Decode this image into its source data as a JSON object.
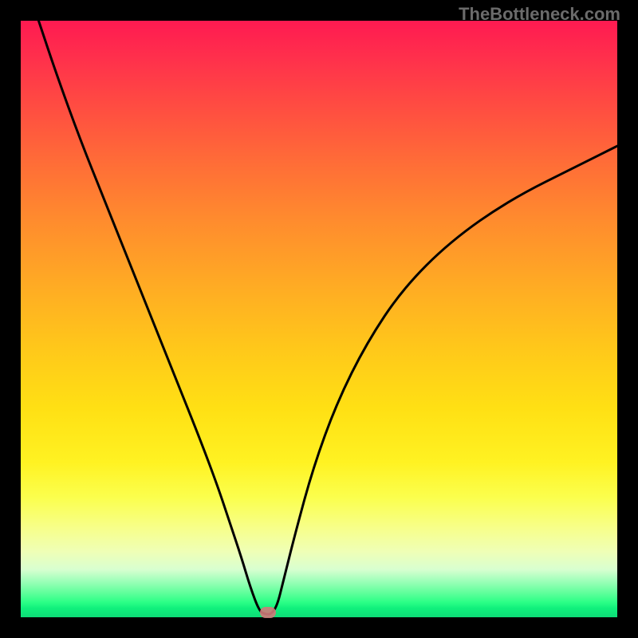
{
  "watermark": "TheBottleneck.com",
  "chart_data": {
    "type": "line",
    "title": "",
    "xlabel": "",
    "ylabel": "",
    "xlim": [
      0,
      100
    ],
    "ylim": [
      0,
      100
    ],
    "background_gradient": {
      "top": "#ff1a51",
      "mid_orange": "#ff8a2e",
      "mid_yellow": "#ffe014",
      "bottom": "#0ddc77"
    },
    "series": [
      {
        "name": "bottleneck-curve",
        "color": "#000000",
        "x": [
          3,
          6,
          10,
          14,
          18,
          22,
          26,
          30,
          33,
          35,
          37,
          38.5,
          40,
          41,
          42,
          43,
          44,
          46,
          49,
          53,
          58,
          64,
          72,
          82,
          94,
          100
        ],
        "y": [
          100,
          91,
          80,
          70,
          60,
          50,
          40,
          30,
          22,
          16,
          10,
          5,
          1,
          0.5,
          0.5,
          2,
          6,
          14,
          25,
          36,
          46,
          55,
          63,
          70,
          76,
          79
        ]
      }
    ],
    "marker": {
      "x_fraction": 0.415,
      "y_fraction": 0.992,
      "color": "#d17a7a"
    }
  }
}
